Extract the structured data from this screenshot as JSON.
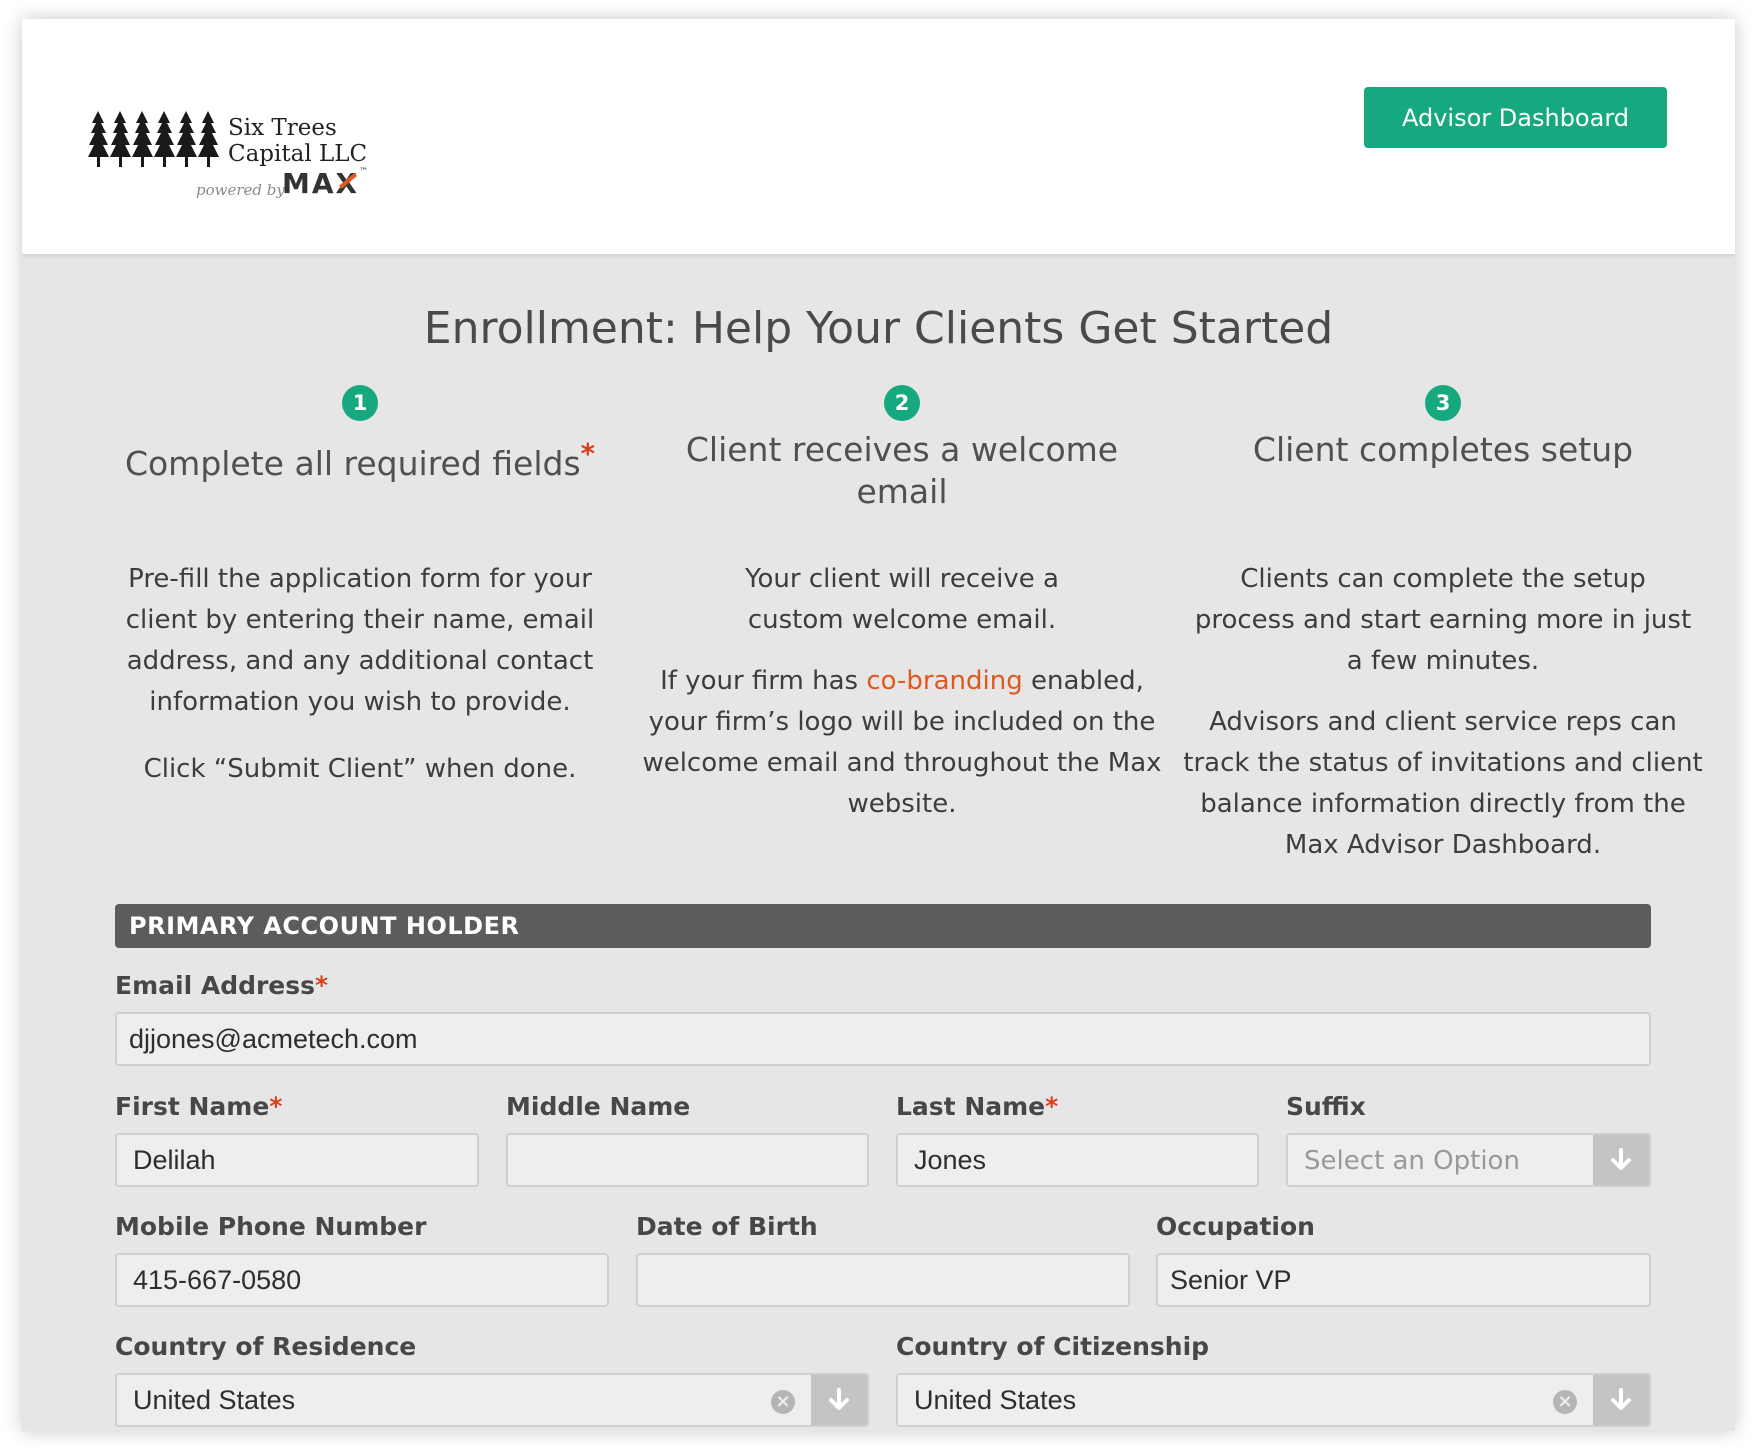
{
  "header": {
    "firm_name_line1": "Six Trees",
    "firm_name_line2": "Capital LLC",
    "powered_by": "powered by",
    "brand": "MAX",
    "advisor_dashboard_label": "Advisor Dashboard"
  },
  "page_title": "Enrollment: Help Your Clients Get Started",
  "steps": [
    {
      "number": "1",
      "title": "Complete all required fields",
      "required_mark": "*",
      "body1": "Pre-fill the application form for your client by entering their name, email address, and any additional contact information you wish to provide.",
      "body2": "Click “Submit Client” when done."
    },
    {
      "number": "2",
      "title": "Client receives a welcome email",
      "body1": "Your client will receive a custom welcome email.",
      "body2_prefix": "If your firm has ",
      "body2_link": "co-branding",
      "body2_suffix": " enabled, your firm’s logo will be included on the welcome email and throughout the Max website."
    },
    {
      "number": "3",
      "title": "Client completes setup",
      "body1": "Clients can complete the setup process and start earning more in just a few minutes.",
      "body2": "Advisors and client service reps can track the status of invitations and client balance information directly from the Max Advisor Dashboard."
    }
  ],
  "form": {
    "section_title": "PRIMARY ACCOUNT HOLDER",
    "required_mark": "*",
    "email": {
      "label": "Email Address",
      "value": "djjones@acmetech.com"
    },
    "first_name": {
      "label": "First Name",
      "value": "Delilah"
    },
    "middle_name": {
      "label": "Middle Name",
      "value": ""
    },
    "last_name": {
      "label": "Last Name",
      "value": "Jones"
    },
    "suffix": {
      "label": "Suffix",
      "placeholder": "Select an Option"
    },
    "mobile_phone": {
      "label": "Mobile Phone Number",
      "value": "415-667-0580"
    },
    "date_of_birth": {
      "label": "Date of Birth",
      "value": ""
    },
    "occupation": {
      "label": "Occupation",
      "value": "Senior VP"
    },
    "country_residence": {
      "label": "Country of Residence",
      "value": "United States"
    },
    "country_citizenship": {
      "label": "Country of Citizenship",
      "value": "United States"
    }
  },
  "colors": {
    "accent": "#16a87f",
    "required": "#dd3e1a",
    "link": "#e2581c",
    "section_bar": "#5c5c5c",
    "background": "#e6e6e6"
  },
  "icons": {
    "logo": "pine-trees-logo",
    "dropdown": "down-arrow-icon",
    "clear": "clear-x-icon"
  }
}
